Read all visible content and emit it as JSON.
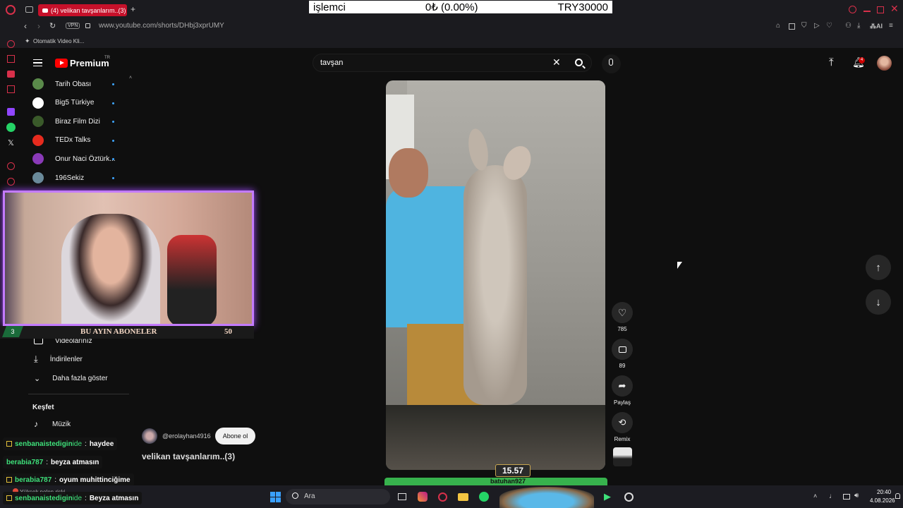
{
  "browser": {
    "tab_title": "(4) velikan tavşanlarım..(3)",
    "vpn_label": "VPN",
    "url": "www.youtube.com/shorts/DHbj3xprUMY",
    "bookmark": "Otomatik Video Kli...",
    "ai_label": "AI"
  },
  "ticker": {
    "name": "işlemci",
    "value": "0₺ (0.00%)",
    "target": "TRY30000"
  },
  "youtube": {
    "logo": "Premium",
    "logo_region": "TR",
    "search_value": "tavşan",
    "notification_count": "4"
  },
  "sidebar": {
    "subscriptions": [
      {
        "label": "Tarih Obası",
        "color": "#5a8a4a"
      },
      {
        "label": "Big5 Türkiye",
        "color": "#ffffff"
      },
      {
        "label": "Biraz Film Dizi",
        "color": "#3a5a2a"
      },
      {
        "label": "TEDx Talks",
        "color": "#e62b1e"
      },
      {
        "label": "Onur Naci Öztürk...",
        "color": "#8a3ab8"
      },
      {
        "label": "196Sekiz",
        "color": "#6a8a9a"
      }
    ],
    "items": [
      {
        "label": "Videolarınız"
      },
      {
        "label": "İndirilenler"
      },
      {
        "label": "Daha fazla göster"
      }
    ],
    "explore_heading": "Keşfet",
    "explore_items": [
      {
        "label": "Müzik"
      }
    ]
  },
  "overlay": {
    "subs_banner": "BU AYIN ABONELER",
    "subs_count": "50",
    "left_badge": "3",
    "channel_handle": "@erolayhan4916",
    "subscribe_label": "Abone ol",
    "video_title": "velikan tavşanlarım..(3)",
    "timer": "15.57",
    "donor": "batuhan927",
    "pollen": "Yüksek polen riski"
  },
  "actions": {
    "likes": "785",
    "comments": "89",
    "share": "Paylaş",
    "remix": "Remix"
  },
  "chat": [
    {
      "user": "senbanaistedigin",
      "highlight": "ide",
      "msg": "haydee",
      "color": "#3ee07a"
    },
    {
      "user": "berabia787",
      "msg": "beyza atmasın",
      "color": "#3ee07a"
    },
    {
      "user": "berabia787",
      "msg": "oyum muhittinciğime",
      "color": "#3ee07a"
    },
    {
      "user": "senbanaistedigin",
      "highlight": "ide",
      "msg": "Beyza atmasın",
      "color": "#3ee07a"
    }
  ],
  "taskbar": {
    "search": "Ara",
    "time": "20:40",
    "date": "4.08.2026"
  }
}
